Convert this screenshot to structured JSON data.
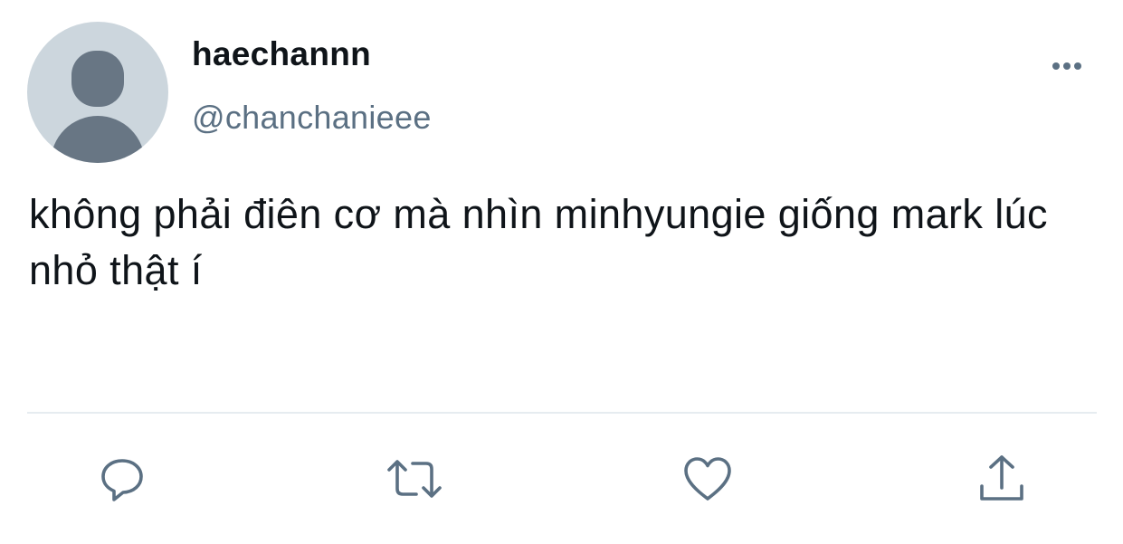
{
  "user": {
    "display_name": "haechannn",
    "handle": "@chanchanieee"
  },
  "tweet": {
    "text": "không phải điên cơ mà nhìn minhyungie giống mark lúc nhỏ thật í"
  },
  "icons": {
    "avatar": "default-profile-avatar",
    "more": "more-options-icon",
    "reply": "reply-icon",
    "retweet": "retweet-icon",
    "like": "like-icon",
    "share": "share-icon"
  },
  "colors": {
    "text_primary": "#0f1419",
    "text_secondary": "#5b7083",
    "icon": "#5b7083",
    "avatar_bg": "#ccd6dd",
    "avatar_fg": "#687684",
    "divider": "#e6ecf0"
  }
}
